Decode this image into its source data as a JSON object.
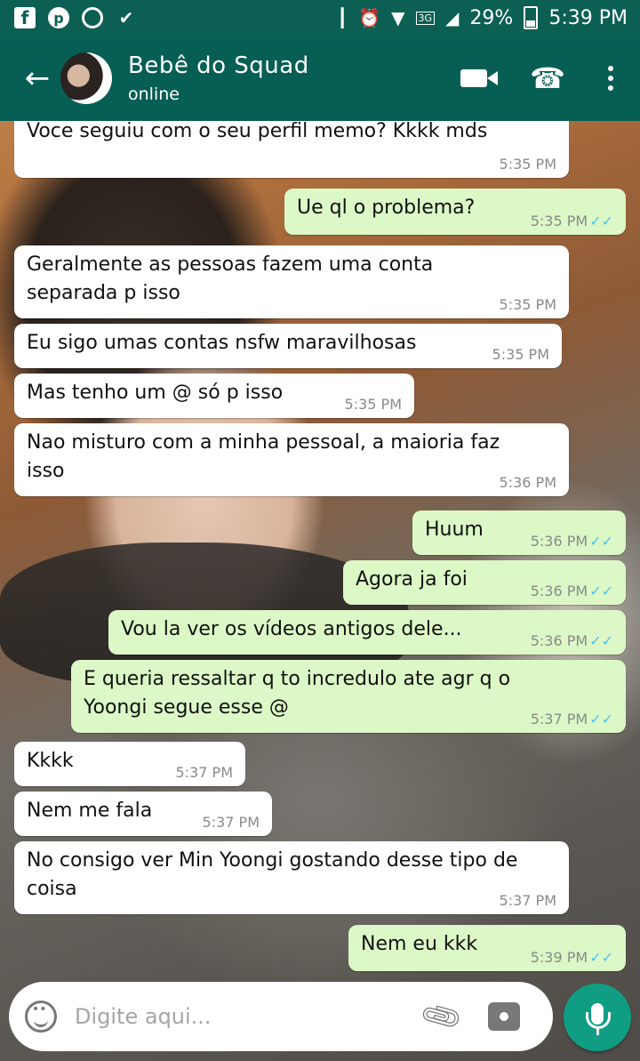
{
  "status_bar": {
    "signal_label": "3G",
    "battery": "29%",
    "time": "5:39 PM"
  },
  "header": {
    "contact_name": "Bebê do Squad",
    "status": "online"
  },
  "messages": [
    {
      "dir": "in",
      "text": "Voce seguiu com o seu perfil memo? Kkkk mds",
      "time": "5:35 PM"
    },
    {
      "dir": "out",
      "text": "Ue ql o problema?",
      "time": "5:35 PM"
    },
    {
      "dir": "in",
      "text": "Geralmente as pessoas fazem uma conta separada p isso",
      "time": "5:35 PM"
    },
    {
      "dir": "in",
      "text": "Eu sigo umas contas nsfw maravilhosas",
      "time": "5:35 PM"
    },
    {
      "dir": "in",
      "text": "Mas tenho um @ só p isso",
      "time": "5:35 PM"
    },
    {
      "dir": "in",
      "text": "Nao misturo com a minha pessoal, a maioria faz isso",
      "time": "5:36 PM"
    },
    {
      "dir": "out",
      "text": "Huum",
      "time": "5:36 PM"
    },
    {
      "dir": "out",
      "text": "Agora ja foi",
      "time": "5:36 PM"
    },
    {
      "dir": "out",
      "text": "Vou la ver os vídeos antigos dele...",
      "time": "5:36 PM"
    },
    {
      "dir": "out",
      "text": "E queria ressaltar q to incredulo ate agr q o Yoongi segue esse @",
      "time": "5:37 PM"
    },
    {
      "dir": "in",
      "text": "Kkkk",
      "time": "5:37 PM"
    },
    {
      "dir": "in",
      "text": "Nem me fala",
      "time": "5:37 PM"
    },
    {
      "dir": "in",
      "text": "No consigo ver Min Yoongi gostando desse tipo de coisa",
      "time": "5:37 PM"
    },
    {
      "dir": "out",
      "text": "Nem eu kkk",
      "time": "5:39 PM"
    }
  ],
  "composer": {
    "placeholder": "Digite aqui..."
  },
  "colors": {
    "header": "#075e54",
    "status_bar": "#0b5f53",
    "outgoing_bubble": "#dcf8c6",
    "incoming_bubble": "#ffffff",
    "read_ticks": "#4fc3f7",
    "mic_button": "#0f9d84"
  },
  "icons": [
    "facebook-icon",
    "pinterest-icon",
    "chrome-icon",
    "download-icon",
    "vibrate-icon",
    "alarm-icon",
    "wifi-icon",
    "signal-icon",
    "battery-icon",
    "back-arrow-icon",
    "video-call-icon",
    "phone-icon",
    "more-options-icon",
    "emoji-icon",
    "attach-icon",
    "camera-icon",
    "mic-icon"
  ]
}
